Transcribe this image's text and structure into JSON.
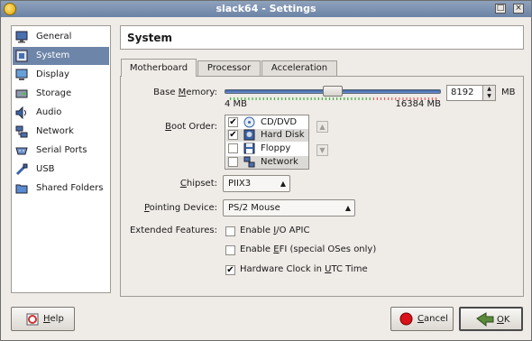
{
  "window": {
    "title": "slack64 - Settings"
  },
  "titlebar_buttons": {
    "maximize": "□",
    "close": "×"
  },
  "sidebar": {
    "items": [
      {
        "label": "General",
        "icon": "monitor-icon"
      },
      {
        "label": "System",
        "icon": "chip-icon"
      },
      {
        "label": "Display",
        "icon": "display-icon"
      },
      {
        "label": "Storage",
        "icon": "storage-icon"
      },
      {
        "label": "Audio",
        "icon": "speaker-icon"
      },
      {
        "label": "Network",
        "icon": "network-icon"
      },
      {
        "label": "Serial Ports",
        "icon": "serial-port-icon"
      },
      {
        "label": "USB",
        "icon": "usb-icon"
      },
      {
        "label": "Shared Folders",
        "icon": "folder-icon"
      }
    ],
    "selected": "System"
  },
  "header": {
    "title": "System"
  },
  "tabs": [
    {
      "label": "Motherboard",
      "active": true
    },
    {
      "label": "Processor",
      "active": false
    },
    {
      "label": "Acceleration",
      "active": false
    }
  ],
  "motherboard": {
    "base_memory": {
      "label_pre": "Base ",
      "label_u": "M",
      "label_post": "emory:",
      "min_label": "4 MB",
      "max_label": "16384 MB",
      "value": "8192",
      "unit": "MB",
      "slider_fraction": 0.5
    },
    "boot_order": {
      "label_u": "B",
      "label_post": "oot Order:",
      "items": [
        {
          "label": "CD/DVD",
          "checked": true,
          "icon": "cd-icon"
        },
        {
          "label": "Hard Disk",
          "checked": true,
          "icon": "hard-disk-icon"
        },
        {
          "label": "Floppy",
          "checked": false,
          "icon": "floppy-icon"
        },
        {
          "label": "Network",
          "checked": false,
          "icon": "network-icon"
        }
      ],
      "check_mark": "✔"
    },
    "chipset": {
      "label_u": "C",
      "label_post": "hipset:",
      "value": "PIIX3"
    },
    "pointing_device": {
      "label_u": "P",
      "label_post": "ointing Device:",
      "value": "PS/2 Mouse"
    },
    "extended_features": {
      "label": "Extended Features:",
      "options": [
        {
          "label_pre": "Enable ",
          "label_u": "I",
          "label_post": "/O APIC",
          "checked": false
        },
        {
          "label_pre": "Enable ",
          "label_u": "E",
          "label_post": "FI (special OSes only)",
          "checked": false
        },
        {
          "label_pre": "Hardware Clock in ",
          "label_u": "U",
          "label_post": "TC Time",
          "checked": true
        }
      ]
    }
  },
  "buttons": {
    "help": {
      "label_u": "H",
      "label_post": "elp"
    },
    "cancel": {
      "label_u": "C",
      "label_post": "ancel"
    },
    "ok": {
      "label_u": "O",
      "label_post": "K"
    }
  },
  "colors": {
    "selection": "#6d85a8",
    "titlebar": "#7b91b1",
    "slider": "#4a70b5"
  }
}
